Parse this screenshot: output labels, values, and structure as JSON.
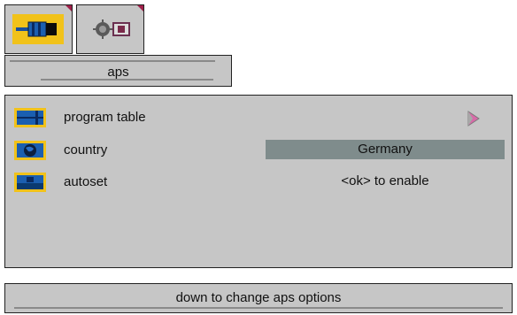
{
  "tabs": [
    {
      "name": "aps",
      "icon": "plug-connector-icon",
      "active": true
    },
    {
      "name": "setup",
      "icon": "device-settings-icon",
      "active": false
    }
  ],
  "page_title": "aps",
  "menu": {
    "items": [
      {
        "label": "program table",
        "icon": "program-table-icon",
        "value": ""
      },
      {
        "label": "country",
        "icon": "globe-icon",
        "value": "Germany"
      },
      {
        "label": "autoset",
        "icon": "autoset-icon",
        "value": "<ok> to enable"
      }
    ]
  },
  "status_hint": "down to change aps options",
  "colors": {
    "accent": "#f1c21a",
    "panel": "#c6c6c6",
    "selection": "#7f8c8c",
    "corner_marker": "#a0204a"
  }
}
